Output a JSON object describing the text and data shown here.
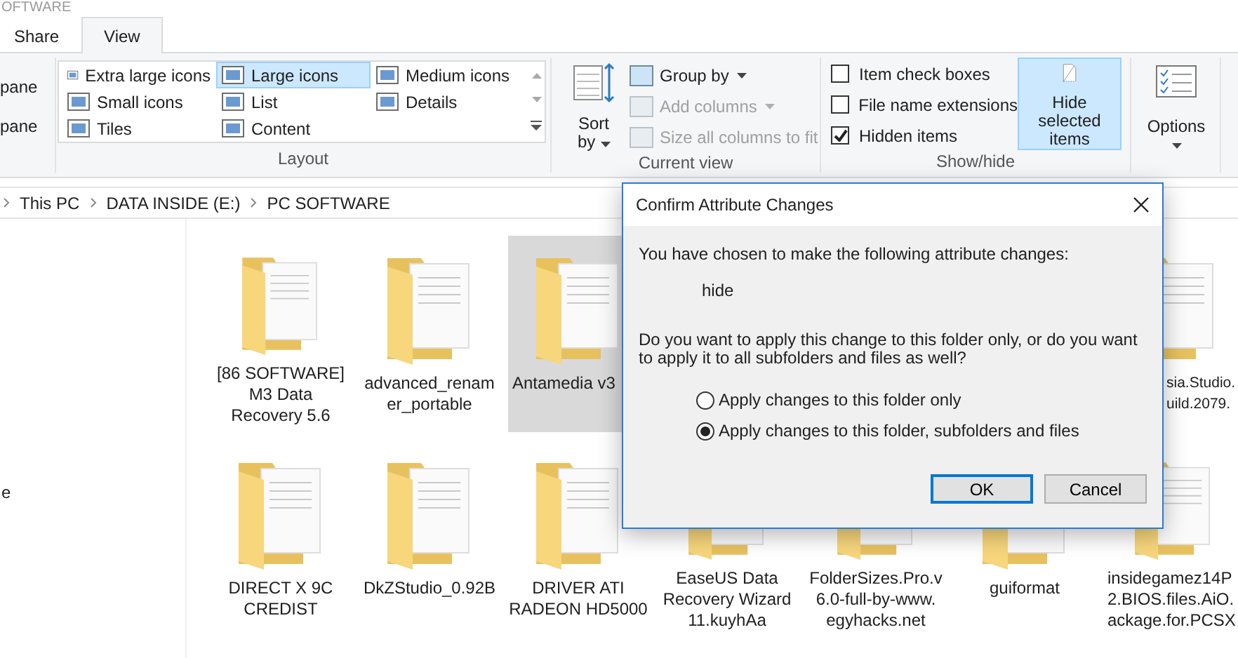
{
  "window": {
    "title": "OFTWARE"
  },
  "ribbon_tabs": [
    {
      "label": "Share",
      "selected": false
    },
    {
      "label": "View",
      "selected": true
    }
  ],
  "panes_group": {
    "items": [
      "pane",
      "pane"
    ]
  },
  "layout_group": {
    "label": "Layout",
    "options": [
      {
        "label": "Extra large icons",
        "selected": false
      },
      {
        "label": "Large icons",
        "selected": true
      },
      {
        "label": "Medium icons",
        "selected": false
      },
      {
        "label": "Small icons",
        "selected": false
      },
      {
        "label": "List",
        "selected": false
      },
      {
        "label": "Details",
        "selected": false
      },
      {
        "label": "Tiles",
        "selected": false
      },
      {
        "label": "Content",
        "selected": false
      }
    ]
  },
  "current_view_group": {
    "label": "Current view",
    "sort_by": [
      "Sort",
      "by"
    ],
    "commands": [
      {
        "label": "Group by",
        "disabled": false,
        "dropdown": true
      },
      {
        "label": "Add columns",
        "disabled": true,
        "dropdown": true
      },
      {
        "label": "Size all columns to fit",
        "disabled": true,
        "dropdown": false
      }
    ]
  },
  "show_hide_group": {
    "label": "Show/hide",
    "checkboxes": [
      {
        "label": "Item check boxes",
        "checked": false
      },
      {
        "label": "File name extensions",
        "checked": false
      },
      {
        "label": "Hidden items",
        "checked": true
      }
    ],
    "hide_selected": {
      "label": "Hide selected items",
      "selected": true
    }
  },
  "options": {
    "label": "Options"
  },
  "breadcrumb": [
    "This PC",
    "DATA INSIDE (E:)",
    "PC SOFTWARE"
  ],
  "nav_pane": {
    "items": [
      "e"
    ]
  },
  "folder_rows": [
    [
      {
        "name": "[86 SOFTWARE]\nM3 Data\nRecovery 5.6",
        "selected": false,
        "kind": "whole"
      },
      {
        "name": "advanced_renam\ner_portable",
        "selected": false,
        "kind": "whole"
      },
      {
        "name": "Antamedia v3",
        "selected": true,
        "kind": "cut_right"
      },
      {
        "name": "sia.Studio.\nuild.2079.",
        "selected": false,
        "kind": "cut_left"
      }
    ],
    [
      {
        "name": "DIRECT X 9C\nCREDIST",
        "selected": false,
        "kind": "whole"
      },
      {
        "name": "DkZStudio_0.92B",
        "selected": false,
        "kind": "whole"
      },
      {
        "name": "DRIVER ATI\nRADEON HD5000",
        "selected": false,
        "kind": "whole"
      },
      {
        "name": "EaseUS Data\nRecovery Wizard\n11.kuyhAa",
        "selected": false,
        "kind": "whole"
      },
      {
        "name": "FolderSizes.Pro.v\n6.0-full-by-www.\negyhacks.net",
        "selected": false,
        "kind": "whole"
      },
      {
        "name": "guiformat",
        "selected": false,
        "kind": "whole"
      },
      {
        "name": "insidegamez14P\n2.BIOS.files.AiO.\nackage.for.PCSX",
        "selected": false,
        "kind": "cut_right"
      }
    ]
  ],
  "dialog": {
    "title": "Confirm Attribute Changes",
    "message": "You have chosen to make the following attribute changes:",
    "attribute": "hide",
    "question": "Do you want to apply this change to this folder only, or do you want to apply it to all subfolders and files as well?",
    "options": [
      {
        "label": "Apply changes to this folder only",
        "selected": false
      },
      {
        "label": "Apply changes to this folder, subfolders and files",
        "selected": true
      }
    ],
    "buttons": [
      {
        "label": "OK",
        "default": true
      },
      {
        "label": "Cancel",
        "default": false
      }
    ]
  }
}
